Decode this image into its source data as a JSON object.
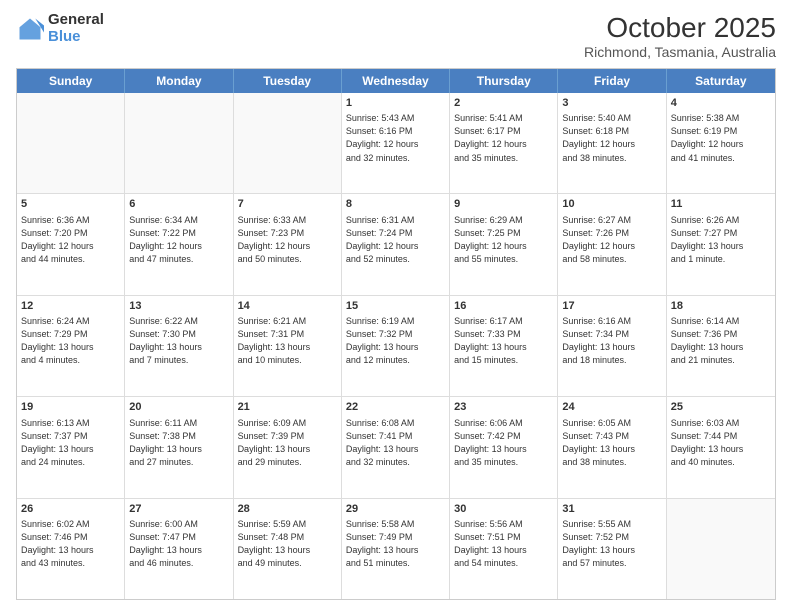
{
  "logo": {
    "general": "General",
    "blue": "Blue"
  },
  "header": {
    "month": "October 2025",
    "location": "Richmond, Tasmania, Australia"
  },
  "weekdays": [
    "Sunday",
    "Monday",
    "Tuesday",
    "Wednesday",
    "Thursday",
    "Friday",
    "Saturday"
  ],
  "weeks": [
    [
      {
        "day": "",
        "info": ""
      },
      {
        "day": "",
        "info": ""
      },
      {
        "day": "",
        "info": ""
      },
      {
        "day": "1",
        "info": "Sunrise: 5:43 AM\nSunset: 6:16 PM\nDaylight: 12 hours\nand 32 minutes."
      },
      {
        "day": "2",
        "info": "Sunrise: 5:41 AM\nSunset: 6:17 PM\nDaylight: 12 hours\nand 35 minutes."
      },
      {
        "day": "3",
        "info": "Sunrise: 5:40 AM\nSunset: 6:18 PM\nDaylight: 12 hours\nand 38 minutes."
      },
      {
        "day": "4",
        "info": "Sunrise: 5:38 AM\nSunset: 6:19 PM\nDaylight: 12 hours\nand 41 minutes."
      }
    ],
    [
      {
        "day": "5",
        "info": "Sunrise: 6:36 AM\nSunset: 7:20 PM\nDaylight: 12 hours\nand 44 minutes."
      },
      {
        "day": "6",
        "info": "Sunrise: 6:34 AM\nSunset: 7:22 PM\nDaylight: 12 hours\nand 47 minutes."
      },
      {
        "day": "7",
        "info": "Sunrise: 6:33 AM\nSunset: 7:23 PM\nDaylight: 12 hours\nand 50 minutes."
      },
      {
        "day": "8",
        "info": "Sunrise: 6:31 AM\nSunset: 7:24 PM\nDaylight: 12 hours\nand 52 minutes."
      },
      {
        "day": "9",
        "info": "Sunrise: 6:29 AM\nSunset: 7:25 PM\nDaylight: 12 hours\nand 55 minutes."
      },
      {
        "day": "10",
        "info": "Sunrise: 6:27 AM\nSunset: 7:26 PM\nDaylight: 12 hours\nand 58 minutes."
      },
      {
        "day": "11",
        "info": "Sunrise: 6:26 AM\nSunset: 7:27 PM\nDaylight: 13 hours\nand 1 minute."
      }
    ],
    [
      {
        "day": "12",
        "info": "Sunrise: 6:24 AM\nSunset: 7:29 PM\nDaylight: 13 hours\nand 4 minutes."
      },
      {
        "day": "13",
        "info": "Sunrise: 6:22 AM\nSunset: 7:30 PM\nDaylight: 13 hours\nand 7 minutes."
      },
      {
        "day": "14",
        "info": "Sunrise: 6:21 AM\nSunset: 7:31 PM\nDaylight: 13 hours\nand 10 minutes."
      },
      {
        "day": "15",
        "info": "Sunrise: 6:19 AM\nSunset: 7:32 PM\nDaylight: 13 hours\nand 12 minutes."
      },
      {
        "day": "16",
        "info": "Sunrise: 6:17 AM\nSunset: 7:33 PM\nDaylight: 13 hours\nand 15 minutes."
      },
      {
        "day": "17",
        "info": "Sunrise: 6:16 AM\nSunset: 7:34 PM\nDaylight: 13 hours\nand 18 minutes."
      },
      {
        "day": "18",
        "info": "Sunrise: 6:14 AM\nSunset: 7:36 PM\nDaylight: 13 hours\nand 21 minutes."
      }
    ],
    [
      {
        "day": "19",
        "info": "Sunrise: 6:13 AM\nSunset: 7:37 PM\nDaylight: 13 hours\nand 24 minutes."
      },
      {
        "day": "20",
        "info": "Sunrise: 6:11 AM\nSunset: 7:38 PM\nDaylight: 13 hours\nand 27 minutes."
      },
      {
        "day": "21",
        "info": "Sunrise: 6:09 AM\nSunset: 7:39 PM\nDaylight: 13 hours\nand 29 minutes."
      },
      {
        "day": "22",
        "info": "Sunrise: 6:08 AM\nSunset: 7:41 PM\nDaylight: 13 hours\nand 32 minutes."
      },
      {
        "day": "23",
        "info": "Sunrise: 6:06 AM\nSunset: 7:42 PM\nDaylight: 13 hours\nand 35 minutes."
      },
      {
        "day": "24",
        "info": "Sunrise: 6:05 AM\nSunset: 7:43 PM\nDaylight: 13 hours\nand 38 minutes."
      },
      {
        "day": "25",
        "info": "Sunrise: 6:03 AM\nSunset: 7:44 PM\nDaylight: 13 hours\nand 40 minutes."
      }
    ],
    [
      {
        "day": "26",
        "info": "Sunrise: 6:02 AM\nSunset: 7:46 PM\nDaylight: 13 hours\nand 43 minutes."
      },
      {
        "day": "27",
        "info": "Sunrise: 6:00 AM\nSunset: 7:47 PM\nDaylight: 13 hours\nand 46 minutes."
      },
      {
        "day": "28",
        "info": "Sunrise: 5:59 AM\nSunset: 7:48 PM\nDaylight: 13 hours\nand 49 minutes."
      },
      {
        "day": "29",
        "info": "Sunrise: 5:58 AM\nSunset: 7:49 PM\nDaylight: 13 hours\nand 51 minutes."
      },
      {
        "day": "30",
        "info": "Sunrise: 5:56 AM\nSunset: 7:51 PM\nDaylight: 13 hours\nand 54 minutes."
      },
      {
        "day": "31",
        "info": "Sunrise: 5:55 AM\nSunset: 7:52 PM\nDaylight: 13 hours\nand 57 minutes."
      },
      {
        "day": "",
        "info": ""
      }
    ]
  ]
}
